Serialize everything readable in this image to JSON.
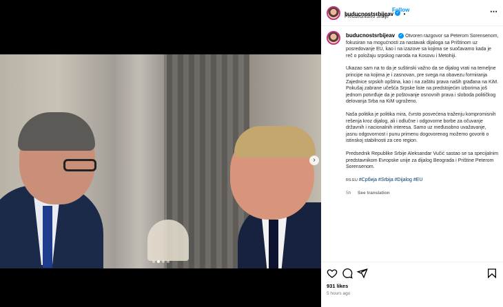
{
  "post": {
    "username": "buducnostsrbijeav",
    "follow_label": "Follow",
    "subtitle": "Predsedništvo Srbije",
    "more_label": "⋯",
    "caption": [
      "Otvoren razgovor sa Peterom Sorensenom, fokusiran na mogućnosti za nastavak dijaloga sa Prištinom uz posredovanje EU, kao i na izazove sa kojima se suočavamo kada je reč o položaju srpskog naroda na Kosovu i Metohiji.",
      "Ukazao sam na to da je suštinski važno da se dijalog vrati na temeljne principe na kojima je i zasnovan, pre svega na obavezu formiranja Zajednice srpskih opština, kao i na zaštitu prava naših građana na KiM. Pokušaj zabrane učešća Srpske liste na predstojećim izborima još jednom potvrđuje da je poštovanje osnovnih prava i sloboda političkog delovanja Srba na KiM ugroženo.",
      "Naša politika je politika mira, čvrsto posvećena traženju kompromisnih rešenja kroz dijalog, ali i odlučne i odgovorne borbe za očuvanje državnih i nacionalnih interesa. Samo uz međusobno uvažavanje, jasnu odgovornost i punu primenu dogovorenog možemo govoriti o istinskoj stabilnosti za ceo region.",
      "Predsednik Republike Srbije Aleksandar Vučić sastao se sa specijalnim predstavnikom Evropske unije za dijalog Beograda i Prištine Peterom Sorensenom."
    ],
    "langs": "RS EU",
    "hashtags": "#Србија #Srbija #Dijalog #EU",
    "age": "5h",
    "translate_label": "See translation",
    "likes": "931 likes",
    "time_ago": "5 hours ago"
  },
  "carousel": {
    "dots": 4,
    "active_index": 1,
    "next_label": "›"
  },
  "colors": {
    "link": "#0095f6",
    "hashtag": "#00376b",
    "muted": "#737373"
  },
  "icons": [
    "heart-icon",
    "comment-icon",
    "share-icon",
    "bookmark-icon",
    "verified-badge-icon"
  ]
}
